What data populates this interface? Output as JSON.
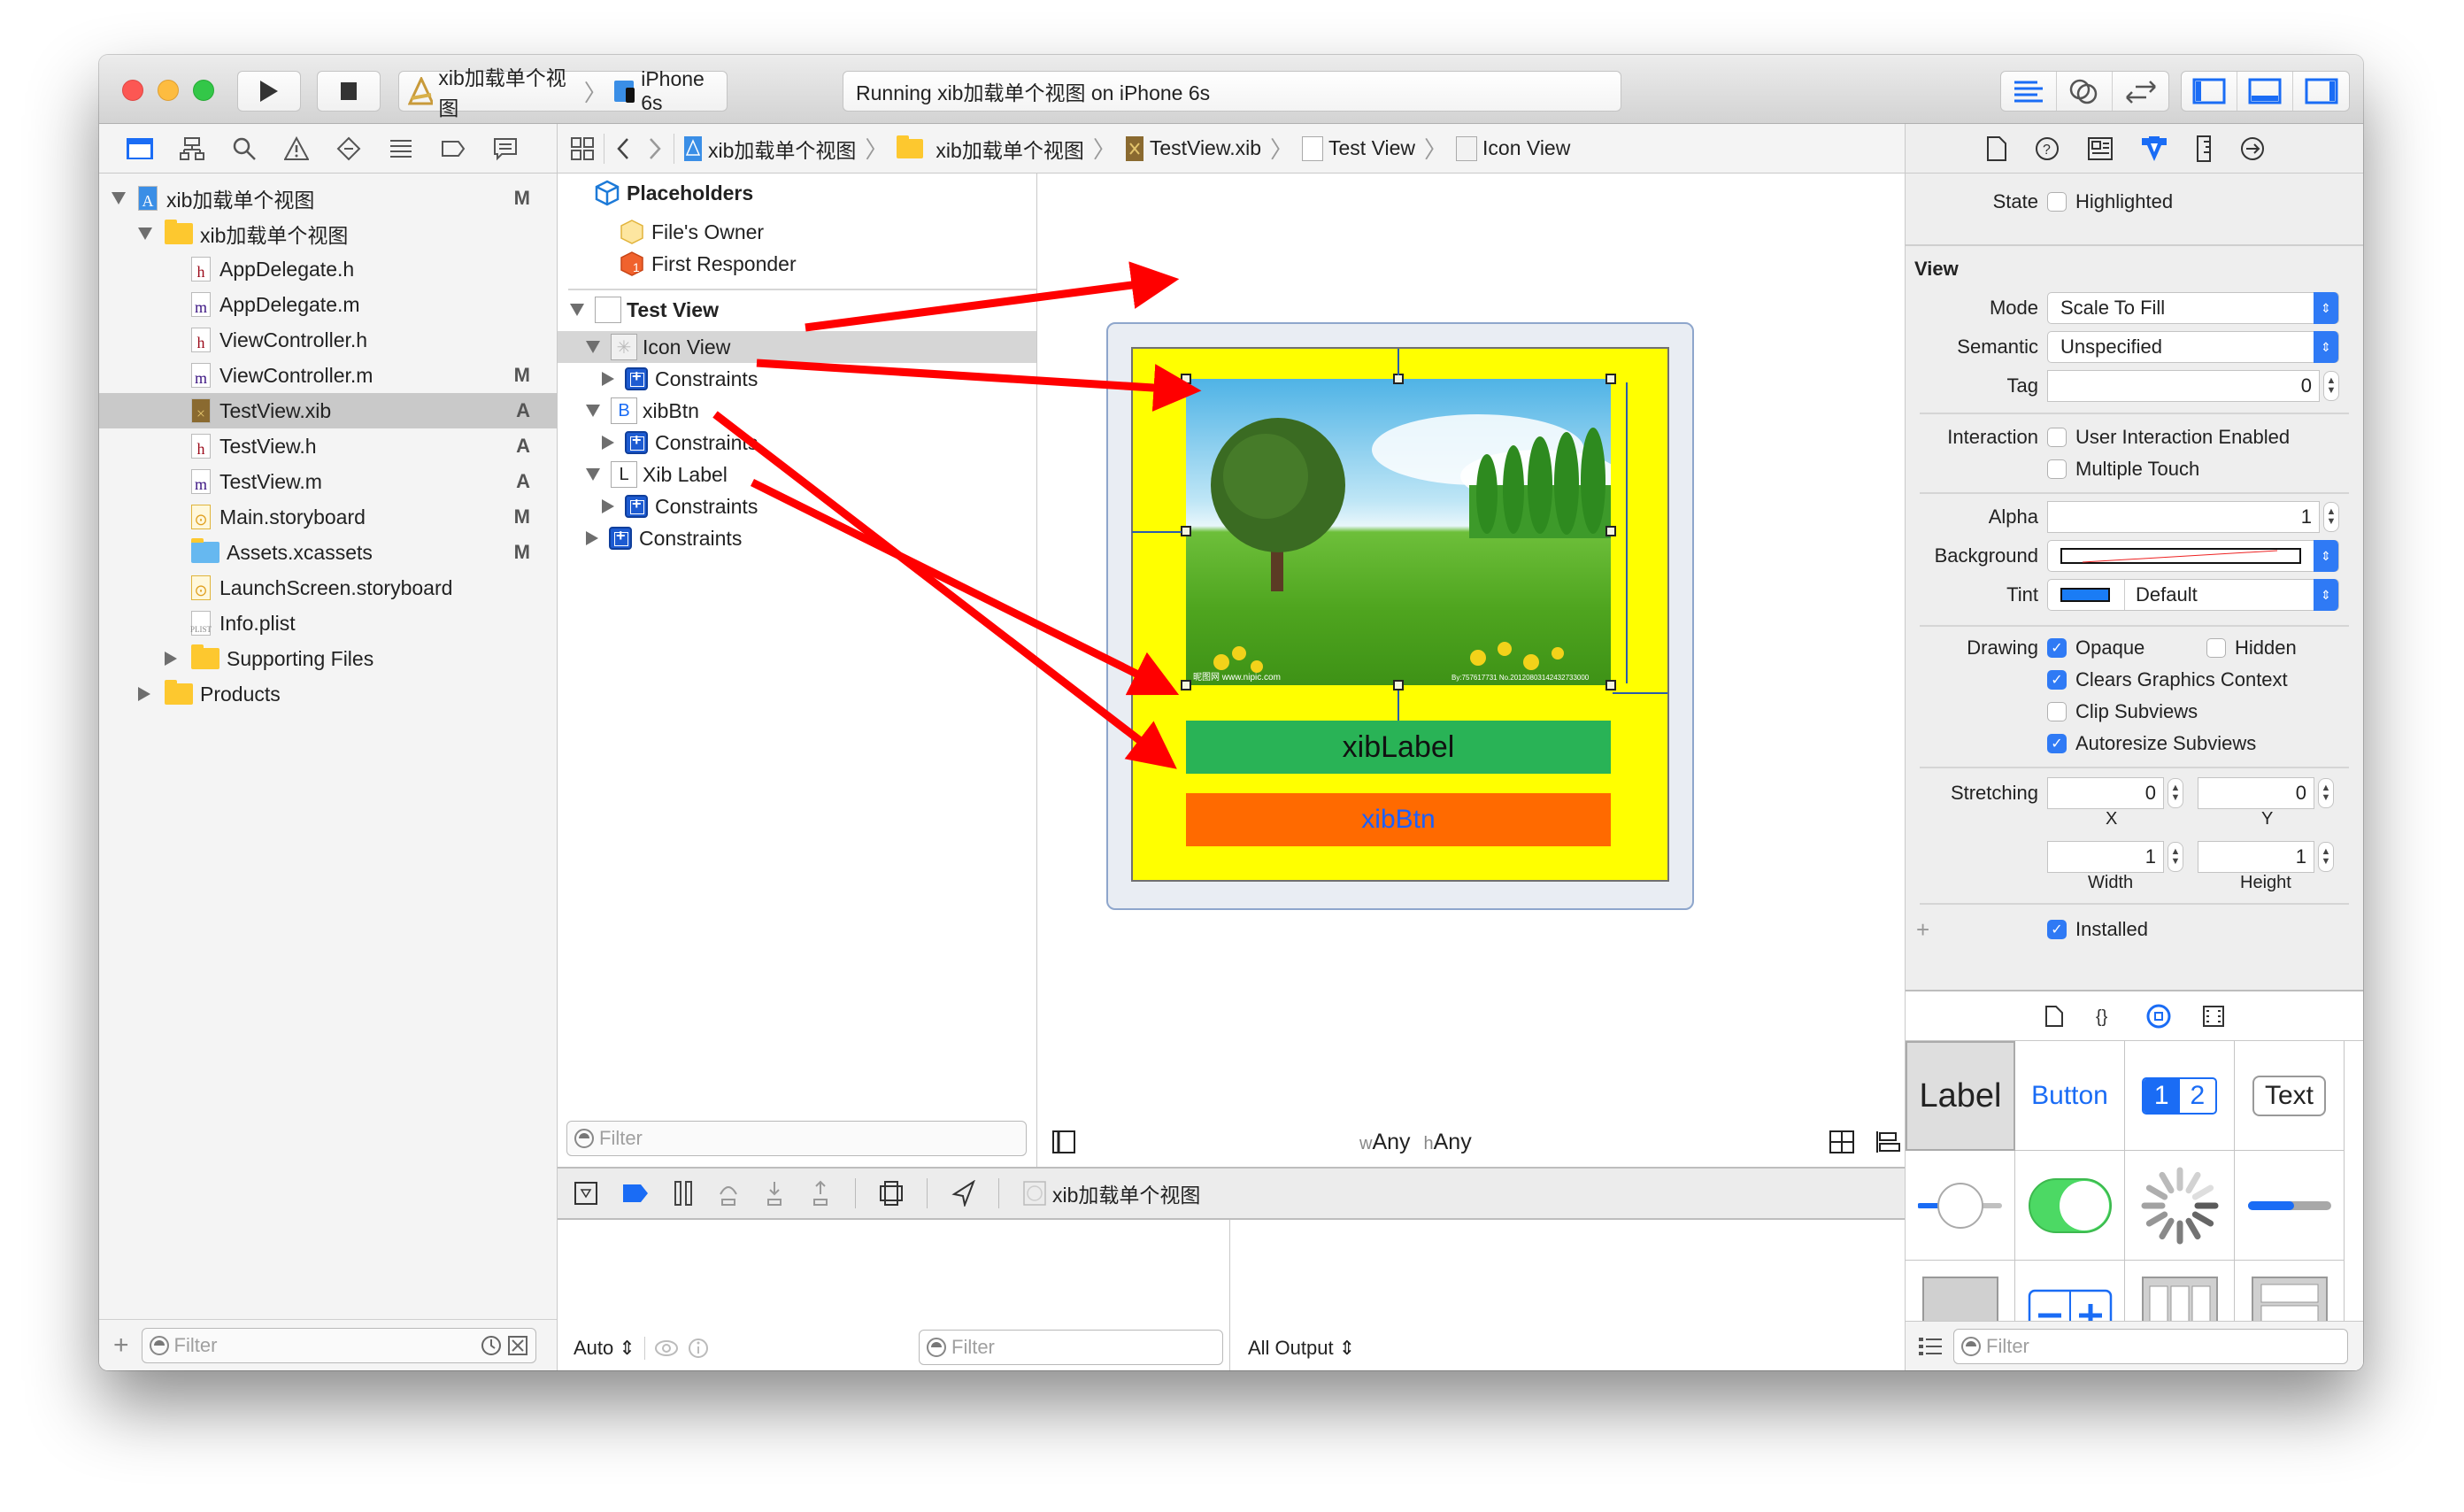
{
  "toolbar": {
    "scheme_name": "xib加载单个视图",
    "device_name": "iPhone 6s",
    "activity_status": "Running xib加载单个视图 on iPhone 6s",
    "editor_modes": [
      "standard-editor-icon",
      "assistant-editor-icon",
      "version-editor-icon"
    ],
    "panel_toggles": [
      "navigator-toggle-icon",
      "debug-area-toggle-icon",
      "utilities-toggle-icon"
    ],
    "accent_color": "#1a6cf5"
  },
  "navigator": {
    "tabs": [
      "project-navigator-icon",
      "symbol-navigator-icon",
      "find-navigator-icon",
      "issue-navigator-icon",
      "test-navigator-icon",
      "debug-navigator-icon",
      "breakpoint-navigator-icon",
      "report-navigator-icon"
    ],
    "tree": [
      {
        "label": "xib加载单个视图",
        "kind": "project",
        "depth": 0,
        "expanded": true,
        "badge": "M"
      },
      {
        "label": "xib加载单个视图",
        "kind": "folder",
        "depth": 1,
        "expanded": true,
        "badge": ""
      },
      {
        "label": "AppDelegate.h",
        "kind": "h",
        "depth": 2,
        "badge": ""
      },
      {
        "label": "AppDelegate.m",
        "kind": "m",
        "depth": 2,
        "badge": ""
      },
      {
        "label": "ViewController.h",
        "kind": "h",
        "depth": 2,
        "badge": ""
      },
      {
        "label": "ViewController.m",
        "kind": "m",
        "depth": 2,
        "badge": "M"
      },
      {
        "label": "TestView.xib",
        "kind": "xib",
        "depth": 2,
        "badge": "A",
        "selected": true
      },
      {
        "label": "TestView.h",
        "kind": "h",
        "depth": 2,
        "badge": "A"
      },
      {
        "label": "TestView.m",
        "kind": "m",
        "depth": 2,
        "badge": "A"
      },
      {
        "label": "Main.storyboard",
        "kind": "storyboard",
        "depth": 2,
        "badge": "M"
      },
      {
        "label": "Assets.xcassets",
        "kind": "assets",
        "depth": 2,
        "badge": "M"
      },
      {
        "label": "LaunchScreen.storyboard",
        "kind": "storyboard",
        "depth": 2,
        "badge": ""
      },
      {
        "label": "Info.plist",
        "kind": "plist",
        "depth": 2,
        "badge": ""
      },
      {
        "label": "Supporting Files",
        "kind": "folder",
        "depth": 2,
        "expanded": false,
        "badge": ""
      },
      {
        "label": "Products",
        "kind": "folder",
        "depth": 1,
        "expanded": false,
        "badge": ""
      }
    ],
    "filter_placeholder": "Filter"
  },
  "jumpbar": {
    "crumbs": [
      "xib加载单个视图",
      "xib加载单个视图",
      "TestView.xib",
      "Test View",
      "Icon View"
    ]
  },
  "outline": {
    "placeholders_heading": "Placeholders",
    "files_owner": "File's Owner",
    "first_responder": "First Responder",
    "test_view": "Test View",
    "items": [
      {
        "label": "Icon View",
        "glyph": "",
        "depth": 1,
        "expanded": true,
        "selected": true
      },
      {
        "label": "Constraints",
        "depth": 2,
        "expanded": false
      },
      {
        "label": "xibBtn",
        "glyph": "B",
        "depth": 1,
        "expanded": true
      },
      {
        "label": "Constraints",
        "depth": 2,
        "expanded": false
      },
      {
        "label": "Xib Label",
        "glyph": "L",
        "depth": 1,
        "expanded": true
      },
      {
        "label": "Constraints",
        "depth": 2,
        "expanded": false
      },
      {
        "label": "Constraints",
        "depth": 1,
        "expanded": false
      }
    ],
    "filter_placeholder": "Filter"
  },
  "canvas": {
    "label_text": "xibLabel",
    "button_text": "xibBtn",
    "image_watermark_left": "昵图网 www.nipic.com",
    "image_watermark_right": "By:757617731 No.20120803142432733000",
    "size_class_w_prefix": "w",
    "size_class_w": "Any",
    "size_class_h_prefix": "h",
    "size_class_h": "Any",
    "colors": {
      "container": "#ffff00",
      "label_bg": "#29b356",
      "button_bg": "#ff6a00",
      "button_text": "#1a60ff"
    }
  },
  "debug": {
    "process_name": "xib加载单个视图",
    "variables_scope": "Auto",
    "filter_placeholder": "Filter",
    "output_scope": "All Output"
  },
  "inspector": {
    "tabs": [
      "file-inspector-icon",
      "quick-help-icon",
      "identity-inspector-icon",
      "attributes-inspector-icon",
      "size-inspector-icon",
      "connections-inspector-icon"
    ],
    "state_label": "State",
    "highlighted_label": "Highlighted",
    "highlighted": false,
    "view_heading": "View",
    "mode_label": "Mode",
    "mode_value": "Scale To Fill",
    "semantic_label": "Semantic",
    "semantic_value": "Unspecified",
    "tag_label": "Tag",
    "tag_value": "0",
    "interaction_label": "Interaction",
    "user_interaction_label": "User Interaction Enabled",
    "user_interaction": false,
    "multiple_touch_label": "Multiple Touch",
    "multiple_touch": false,
    "alpha_label": "Alpha",
    "alpha_value": "1",
    "background_label": "Background",
    "tint_label": "Tint",
    "tint_value": "Default",
    "tint_color": "#1a7cf5",
    "drawing_label": "Drawing",
    "opaque_label": "Opaque",
    "opaque": true,
    "hidden_label": "Hidden",
    "hidden": false,
    "clears_label": "Clears Graphics Context",
    "clears": true,
    "clip_label": "Clip Subviews",
    "clip": false,
    "autoresize_label": "Autoresize Subviews",
    "autoresize": true,
    "stretching_label": "Stretching",
    "stretch_x": "0",
    "stretch_y": "0",
    "stretch_w": "1",
    "stretch_h": "1",
    "x_label": "X",
    "y_label": "Y",
    "width_label": "Width",
    "height_label": "Height",
    "installed_label": "Installed",
    "installed": true
  },
  "library": {
    "tabs": [
      "file-template-icon",
      "code-snippet-icon",
      "object-library-icon",
      "media-library-icon"
    ],
    "items": [
      "Label",
      "Button",
      "1",
      "2",
      "Text"
    ],
    "filter_placeholder": "Filter"
  }
}
